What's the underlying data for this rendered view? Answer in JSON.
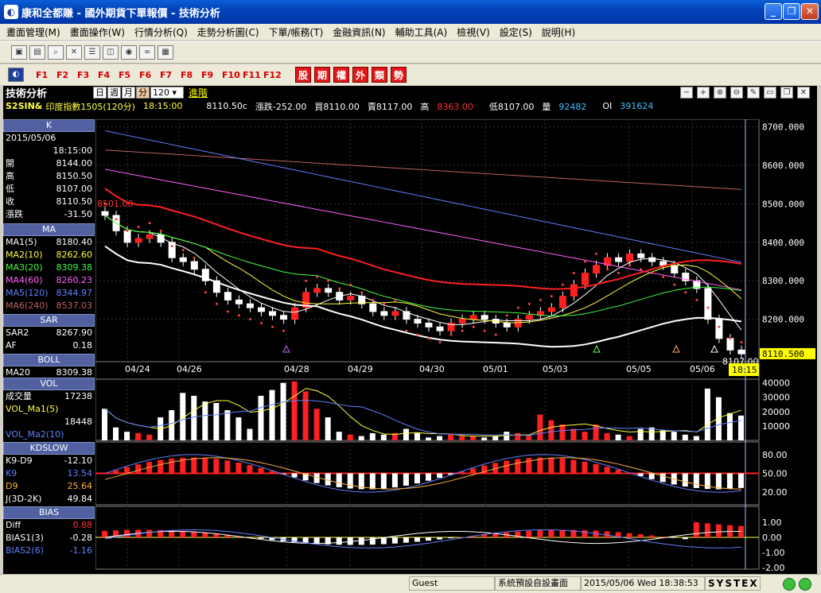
{
  "window": {
    "title": "康和全都賺 - 國外期貨下單報價 - 技術分析"
  },
  "menu": [
    "畫面管理(M)",
    "畫面操作(W)",
    "行情分析(Q)",
    "走勢分析圖(C)",
    "下單/帳務(T)",
    "金融資訊(N)",
    "輔助工具(A)",
    "檢視(V)",
    "設定(S)",
    "說明(H)"
  ],
  "fkeys": [
    "F1",
    "F2",
    "F3",
    "F4",
    "F5",
    "F6",
    "F7",
    "F8",
    "F9",
    "F10",
    "F11",
    "F12"
  ],
  "category_buttons": [
    "股",
    "期",
    "權",
    "外",
    "類",
    "勢"
  ],
  "chart_header": {
    "title": "技術分析",
    "periods": [
      "日",
      "週",
      "月",
      "分"
    ],
    "selected_period": "分",
    "interval": "120",
    "advanced": "進階",
    "symbol": "S2SIN&",
    "name": "印度指數1505(120分)",
    "time": "18:15:00",
    "last": "8110.50c",
    "change": "漲跌-252.00",
    "bid": "買8110.00",
    "ask": "賣8117.00",
    "high_label": "高",
    "high": "8363.00",
    "low": "低8107.00",
    "vol_label": "量",
    "volume": "92482",
    "oi_label": "OI",
    "oi": "391624"
  },
  "left_panel": {
    "k": {
      "header": "K",
      "date": "2015/05/06",
      "time": "18:15:00",
      "rows": [
        {
          "label": "開",
          "value": "8144.00"
        },
        {
          "label": "高",
          "value": "8150.50"
        },
        {
          "label": "低",
          "value": "8107.00"
        },
        {
          "label": "收",
          "value": "8110.50"
        },
        {
          "label": "漲跌",
          "value": "-31.50"
        }
      ]
    },
    "ma": {
      "header": "MA",
      "rows": [
        {
          "label": "MA1(5)",
          "value": "8180.40",
          "color": "#ffffff"
        },
        {
          "label": "MA2(10)",
          "value": "8262.60",
          "color": "#ffff40"
        },
        {
          "label": "MA3(20)",
          "value": "8309.38",
          "color": "#40ff40"
        },
        {
          "label": "MA4(60)",
          "value": "8260.23",
          "color": "#ff60ff"
        },
        {
          "label": "MA5(120)",
          "value": "8344.97",
          "color": "#6080ff"
        },
        {
          "label": "MA6(240)",
          "value": "8537.03",
          "color": "#c06060"
        }
      ]
    },
    "sar": {
      "header": "SAR",
      "rows": [
        {
          "label": "SAR2",
          "value": "8267.90"
        },
        {
          "label": "AF",
          "value": "0.18"
        }
      ]
    },
    "boll": {
      "header": "BOLL",
      "rows": [
        {
          "label": "MA20",
          "value": "8309.38"
        }
      ]
    },
    "vol": {
      "header": "VOL",
      "rows": [
        {
          "label": "成交量",
          "value": "17238"
        },
        {
          "label": "VOL_Ma1(5)",
          "value": ""
        },
        {
          "label": "",
          "value": "18448"
        },
        {
          "label": "VOL_Ma2(10)",
          "value": ""
        }
      ]
    },
    "kd": {
      "header": "KDSLOW",
      "rows": [
        {
          "label": "K9-D9",
          "value": "-12.10"
        },
        {
          "label": "K9",
          "value": "13.54"
        },
        {
          "label": "D9",
          "value": "25.64"
        },
        {
          "label": "J(3D-2K)",
          "value": "49.84"
        }
      ]
    },
    "bias": {
      "header": "BIAS",
      "rows": [
        {
          "label": "Diff",
          "value": "0.88"
        },
        {
          "label": "BIAS1(3)",
          "value": "-0.28"
        },
        {
          "label": "BIAS2(6)",
          "value": "-1.16"
        }
      ]
    }
  },
  "price_axis": [
    "8700.000",
    "8600.000",
    "8500.000",
    "8400.000",
    "8300.000",
    "8200.000"
  ],
  "last_price_tag": "8110.500",
  "low_marker": "8107.00",
  "high_marker": "8501.00",
  "date_labels": [
    "04/24",
    "04/26",
    "04/28",
    "04/29",
    "04/30",
    "05/01",
    "05/03",
    "05/05",
    "05/06"
  ],
  "time_tag": "18:15",
  "vol_axis": [
    "40000",
    "30000",
    "20000",
    "10000"
  ],
  "kd_axis": [
    "80.00",
    "50.00",
    "20.00"
  ],
  "bias_axis": [
    "1.00",
    "0.00",
    "-1.00",
    "-2.00"
  ],
  "statusbar": {
    "user": "Guest",
    "screen": "系統預設自設畫面",
    "datetime": "2015/05/06 Wed 18:38:53",
    "brand": "SYSTEX"
  },
  "chart_data": {
    "type": "candlestick",
    "closes": [
      8470,
      8430,
      8400,
      8410,
      8420,
      8400,
      8360,
      8350,
      8330,
      8300,
      8270,
      8250,
      8240,
      8230,
      8220,
      8210,
      8200,
      8230,
      8270,
      8280,
      8270,
      8250,
      8260,
      8240,
      8220,
      8210,
      8220,
      8200,
      8190,
      8180,
      8170,
      8190,
      8200,
      8210,
      8200,
      8190,
      8180,
      8200,
      8210,
      8220,
      8230,
      8260,
      8290,
      8320,
      8340,
      8360,
      8350,
      8370,
      8360,
      8350,
      8340,
      8320,
      8300,
      8280,
      8200,
      8150,
      8120,
      8110
    ],
    "price_range": [
      8100,
      8720
    ],
    "volumes": [
      22000,
      9000,
      6000,
      5000,
      4000,
      16000,
      21000,
      33000,
      31000,
      27000,
      26000,
      21000,
      16000,
      8000,
      31000,
      35000,
      40000,
      41000,
      34000,
      22000,
      16000,
      6000,
      4000,
      3000,
      5000,
      4000,
      5000,
      8000,
      5000,
      2000,
      3000,
      4000,
      3000,
      3000,
      2000,
      3000,
      6000,
      5000,
      3000,
      18000,
      14000,
      11000,
      8000,
      6000,
      11000,
      5000,
      4000,
      3000,
      8000,
      9000,
      7000,
      6000,
      4000,
      3000,
      36000,
      30000,
      19000,
      17238
    ],
    "vol_range": [
      0,
      42000
    ]
  }
}
